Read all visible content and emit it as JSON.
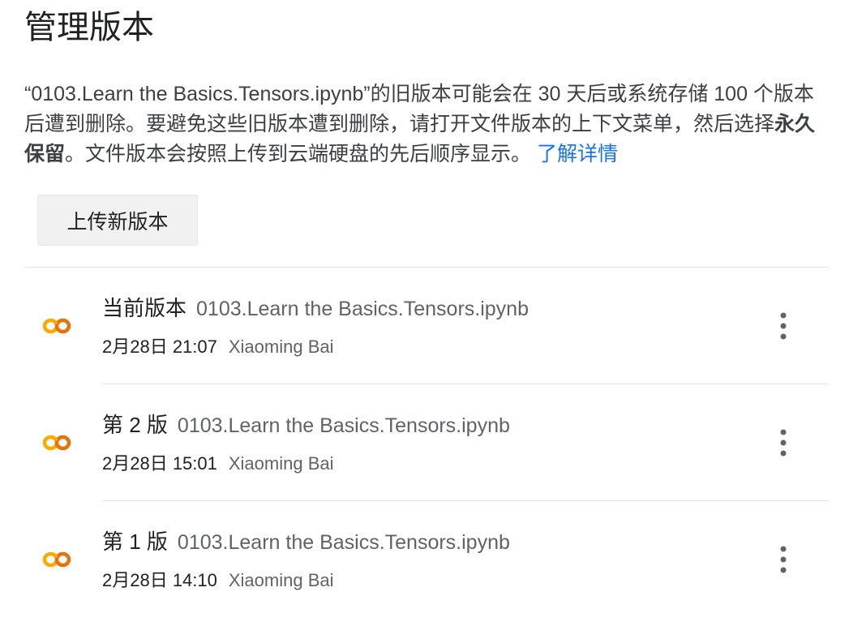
{
  "page": {
    "title": "管理版本",
    "description_part1": "“0103.Learn the Basics.Tensors.ipynb”的旧版本可能会在 30 天后或系统存储 100 个版本后遭到删除。要避免这些旧版本遭到删除，请打开文件版本的上下文菜单，然后选择",
    "description_bold": "永久保留",
    "description_part2": "。文件版本会按照上传到云端硬盘的先后顺序显示。",
    "learn_more": "了解详情",
    "upload_button": "上传新版本"
  },
  "versions": [
    {
      "label": "当前版本",
      "file_name": "0103.Learn the Basics.Tensors.ipynb",
      "date": "2月28日 21:07",
      "author": "Xiaoming Bai",
      "icon": "colab-icon"
    },
    {
      "label": "第 2 版",
      "file_name": "0103.Learn the Basics.Tensors.ipynb",
      "date": "2月28日 15:01",
      "author": "Xiaoming Bai",
      "icon": "colab-icon"
    },
    {
      "label": "第 1 版",
      "file_name": "0103.Learn the Basics.Tensors.ipynb",
      "date": "2月28日 14:10",
      "author": "Xiaoming Bai",
      "icon": "colab-icon"
    }
  ],
  "colors": {
    "link": "#1a73e8",
    "colab_orange": "#f9ab00",
    "colab_dark_orange": "#e8710a",
    "divider": "#e6e6e6",
    "button_bg": "#f1f1f1"
  }
}
